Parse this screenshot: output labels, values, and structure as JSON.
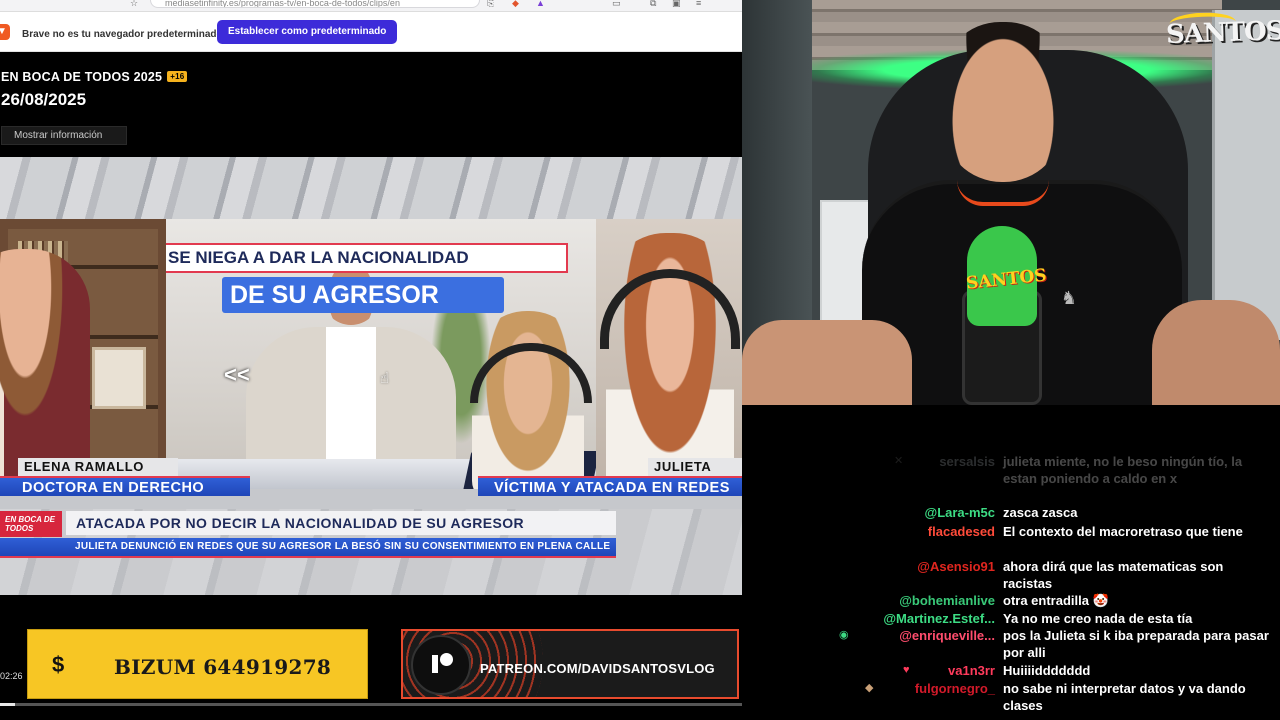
{
  "browser": {
    "url_fragment": "mediasetinfinity.es/programas-tv/en-boca-de-todos/clips/en",
    "notice_text": "Brave no es tu navegador predeterminado",
    "notice_button": "Establecer como predeterminado"
  },
  "show": {
    "title": "EN BOCA DE TODOS 2025",
    "age_rating": "+16",
    "date": "26/08/2025",
    "info_button": "Mostrar información"
  },
  "video": {
    "banner_top": "SE NIEGA A DAR LA NACIONALIDAD",
    "banner_main": "DE SU AGRESOR",
    "nav_prev": "<<",
    "nav_next": ">>",
    "guest_left_name": "ELENA RAMALLO",
    "guest_left_role": "DOCTORA EN DERECHO",
    "guest_right_name": "JULIETA",
    "guest_right_role": "VÍCTIMA Y ATACADA EN REDES",
    "show_logo": "EN BOCA DE TODOS",
    "headline": "ATACADA POR NO DECIR LA NACIONALIDAD DE SU AGRESOR",
    "subline": "JULIETA DENUNCIÓ EN REDES QUE SU AGRESOR LA BESÓ SIN SU CONSENTIMIENTO EN PLENA CALLE",
    "timestamp": "02:26",
    "progress": 0.02
  },
  "promo": {
    "bizum_icon": "dollar-icon",
    "bizum_label": "BIZUM 644919278",
    "patreon_icon": "patreon-icon",
    "patreon_label": "PATREON.COM/DAVIDSANTOSVLOG"
  },
  "webcam": {
    "channel_logo": "SANTOS",
    "mic_logo": "SANTOS"
  },
  "chat": {
    "messages": [
      {
        "user": "sersalsis",
        "user_color": "#9aa0a6",
        "text": "julieta miente, no le beso ningún tío, la estan poniendo a caldo en x",
        "faded": true
      },
      {
        "user": "@Lara-m5c",
        "user_color": "#3ddc84",
        "text": "zasca zasca"
      },
      {
        "user": "flacadesed",
        "user_color": "#ff4b3a",
        "text": "El contexto del macroretraso que tiene"
      },
      {
        "user": "@Asensio91",
        "user_color": "#e0261f",
        "text": "ahora dirá que las matematicas son racistas"
      },
      {
        "user": "@bohemianlive",
        "user_color": "#39c978",
        "text": "otra entradilla 🤡"
      },
      {
        "user": "@Martinez.Estef...",
        "user_color": "#3ddc84",
        "text": "Ya no me creo nada de esta tía"
      },
      {
        "user": "@enriqueville...",
        "user_color": "#ff4d6d",
        "text": "pos la Julieta si k iba preparada para pasar por alli"
      },
      {
        "user": "va1n3rr",
        "user_color": "#ff3b5c",
        "text": "Huiiiiddddddd"
      },
      {
        "user": "fulgornegro_",
        "user_color": "#d31a2a",
        "text": "no sabe ni interpretar datos y va dando clases"
      }
    ]
  },
  "colors": {
    "accent_blue": "#3d2bd9",
    "bizum_yellow": "#f7c624",
    "patreon_red": "#e84b2e",
    "tv_blue": "#2f5fd6",
    "tv_red": "#e23a4f"
  }
}
